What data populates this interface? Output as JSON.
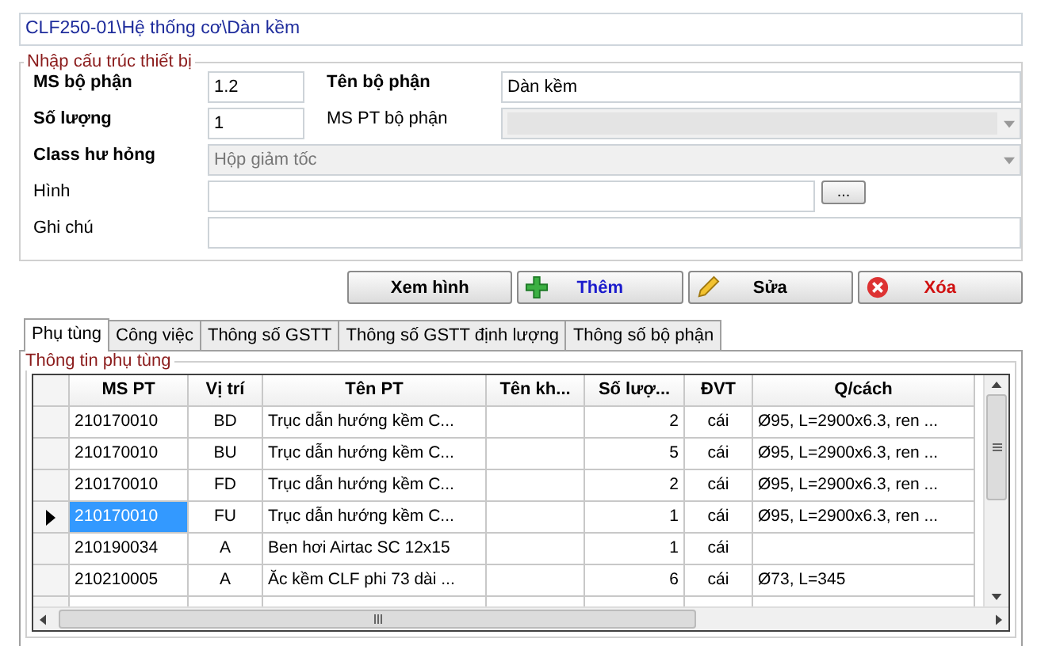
{
  "path": "CLF250-01\\Hệ thống cơ\\Dàn kềm",
  "group": {
    "title": "Nhập cấu trúc thiết bị",
    "ms_bo_phan": {
      "label": "MS bộ phận",
      "value": "1.2"
    },
    "ten_bo_phan": {
      "label": "Tên bộ phận",
      "value": "Dàn kềm"
    },
    "so_luong": {
      "label": "Số lượng",
      "value": "1"
    },
    "ms_pt_bo_phan": {
      "label": "MS PT bộ phận",
      "disabled": true
    },
    "class_hu_hong": {
      "label": "Class hư hỏng",
      "value": "Hộp giảm tốc",
      "disabled": true
    },
    "hinh": {
      "label": "Hình",
      "button": "..."
    },
    "ghi_chu": {
      "label": "Ghi chú"
    }
  },
  "buttons": [
    {
      "kind": "view",
      "label": "Xem hình"
    },
    {
      "kind": "add",
      "label": "Thêm"
    },
    {
      "kind": "edit",
      "label": "Sửa"
    },
    {
      "kind": "delete",
      "label": "Xóa"
    }
  ],
  "tabs": [
    {
      "label": "Phụ tùng",
      "selected": true
    },
    {
      "label": "Công việc",
      "selected": false
    },
    {
      "label": "Thông số GSTT",
      "selected": false
    },
    {
      "label": "Thông số GSTT định lượng",
      "selected": false
    },
    {
      "label": "Thông số bộ phận",
      "selected": false
    }
  ],
  "parts": {
    "title": "Thông tin phụ tùng",
    "columns": [
      "MS PT",
      "Vị trí",
      "Tên PT",
      "Tên kh...",
      "Số lượ...",
      "ĐVT",
      "Q/cách"
    ],
    "rows": [
      {
        "selected": false,
        "cells": [
          "210170010",
          "BD",
          "Trục dẫn hướng kềm C...",
          "",
          "2",
          "cái",
          "Ø95, L=2900x6.3, ren ..."
        ]
      },
      {
        "selected": false,
        "cells": [
          "210170010",
          "BU",
          "Trục dẫn hướng kềm C...",
          "",
          "5",
          "cái",
          "Ø95, L=2900x6.3, ren ..."
        ]
      },
      {
        "selected": false,
        "cells": [
          "210170010",
          "FD",
          "Trục dẫn hướng kềm C...",
          "",
          "2",
          "cái",
          "Ø95, L=2900x6.3, ren ..."
        ]
      },
      {
        "selected": true,
        "cells": [
          "210170010",
          "FU",
          "Trục dẫn hướng kềm C...",
          "",
          "1",
          "cái",
          "Ø95, L=2900x6.3, ren ..."
        ]
      },
      {
        "selected": false,
        "cells": [
          "210190034",
          "A",
          "Ben hơi Airtac SC 12x15",
          "",
          "1",
          "cái",
          ""
        ]
      },
      {
        "selected": false,
        "cells": [
          "210210005",
          "A",
          "Ăc kềm CLF phi 73 dài ...",
          "",
          "6",
          "cái",
          "Ø73, L=345"
        ]
      }
    ]
  }
}
